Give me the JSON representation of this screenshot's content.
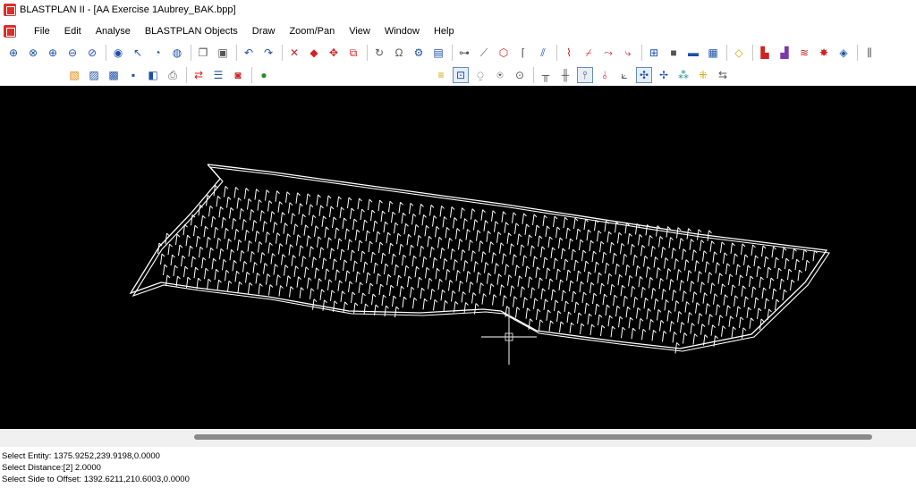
{
  "window": {
    "title": "BLASTPLAN II - [AA Exercise 1Aubrey_BAK.bpp]"
  },
  "menu": [
    "File",
    "Edit",
    "Analyse",
    "BLASTPLAN Objects",
    "Draw",
    "Zoom/Pan",
    "View",
    "Window",
    "Help"
  ],
  "toolbar1": [
    {
      "name": "zoom-extents-icon",
      "glyph": "⊕",
      "color": "blue"
    },
    {
      "name": "zoom-window-icon",
      "glyph": "⊗",
      "color": "blue"
    },
    {
      "name": "zoom-in-icon",
      "glyph": "⊕",
      "color": "blue"
    },
    {
      "name": "zoom-out-icon",
      "glyph": "⊖",
      "color": "blue"
    },
    {
      "name": "zoom-previous-icon",
      "glyph": "⊘",
      "color": "blue"
    },
    {
      "sep": true
    },
    {
      "name": "pan-icon",
      "glyph": "◉",
      "color": "blue"
    },
    {
      "name": "pick-icon",
      "glyph": "↖",
      "color": "blue"
    },
    {
      "name": "rotate-view-icon",
      "glyph": "◔",
      "color": "blue"
    },
    {
      "name": "globe-view-icon",
      "glyph": "◍",
      "color": "blue"
    },
    {
      "sep": true
    },
    {
      "name": "copy-icon",
      "glyph": "❐",
      "color": "gray"
    },
    {
      "name": "paste-icon",
      "glyph": "▣",
      "color": "gray"
    },
    {
      "sep": true
    },
    {
      "name": "undo-icon",
      "glyph": "↶",
      "color": "blue"
    },
    {
      "name": "redo-icon",
      "glyph": "↷",
      "color": "blue"
    },
    {
      "sep": true
    },
    {
      "name": "delete-icon",
      "glyph": "✕",
      "color": "red"
    },
    {
      "name": "erase-icon",
      "glyph": "◆",
      "color": "red"
    },
    {
      "name": "move-icon",
      "glyph": "✥",
      "color": "red"
    },
    {
      "name": "copy-object-icon",
      "glyph": "⧉",
      "color": "red"
    },
    {
      "sep": true
    },
    {
      "name": "refresh-icon",
      "glyph": "↻",
      "color": "gray"
    },
    {
      "name": "magnet-icon",
      "glyph": "Ω",
      "color": "gray"
    },
    {
      "name": "settings-icon",
      "glyph": "⚙",
      "color": "blue"
    },
    {
      "name": "layers-icon",
      "glyph": "▤",
      "color": "blue"
    },
    {
      "sep": true
    },
    {
      "name": "link-icon",
      "glyph": "⊶",
      "color": "gray"
    },
    {
      "name": "line-icon",
      "glyph": "⟋",
      "color": "gray"
    },
    {
      "name": "polygon-icon",
      "glyph": "⬡",
      "color": "red"
    },
    {
      "name": "fillet-icon",
      "glyph": "⌈",
      "color": "gray"
    },
    {
      "name": "offset-icon",
      "glyph": "⫽",
      "color": "blue"
    },
    {
      "sep": true
    },
    {
      "name": "break-icon",
      "glyph": "⌇",
      "color": "red"
    },
    {
      "name": "trim-icon",
      "glyph": "⌿",
      "color": "red"
    },
    {
      "name": "extend-icon",
      "glyph": "⤳",
      "color": "red"
    },
    {
      "name": "split-icon",
      "glyph": "⤷",
      "color": "red"
    },
    {
      "sep": true
    },
    {
      "name": "table-icon",
      "glyph": "⊞",
      "color": "blue"
    },
    {
      "name": "block-icon",
      "glyph": "■",
      "color": "gray"
    },
    {
      "name": "ruler-icon",
      "glyph": "▬",
      "color": "blue"
    },
    {
      "name": "grid-icon",
      "glyph": "▦",
      "color": "blue"
    },
    {
      "sep": true
    },
    {
      "name": "shape-icon",
      "glyph": "◇",
      "color": "yellow"
    },
    {
      "sep": true
    },
    {
      "name": "chart-icon",
      "glyph": "▙",
      "color": "red"
    },
    {
      "name": "histogram-icon",
      "glyph": "▟",
      "color": "purple"
    },
    {
      "name": "wave-icon",
      "glyph": "≋",
      "color": "red"
    },
    {
      "name": "burst-icon",
      "glyph": "✸",
      "color": "red"
    },
    {
      "name": "palette-icon",
      "glyph": "◈",
      "color": "blue"
    },
    {
      "sep": true
    },
    {
      "name": "comb-icon",
      "glyph": "⫼",
      "color": "gray"
    }
  ],
  "toolbar2": [
    {
      "name": "new-file-icon",
      "glyph": "▧",
      "color": "orange"
    },
    {
      "name": "open-file-icon",
      "glyph": "▨",
      "color": "blue"
    },
    {
      "name": "folder-icon",
      "glyph": "▩",
      "color": "blue"
    },
    {
      "name": "save-icon",
      "glyph": "▪",
      "color": "blue"
    },
    {
      "name": "save-all-icon",
      "glyph": "◧",
      "color": "blue"
    },
    {
      "name": "print-icon",
      "glyph": "⎙",
      "color": "gray"
    },
    {
      "sep": true
    },
    {
      "name": "export-icon",
      "glyph": "⇄",
      "color": "red"
    },
    {
      "name": "report-icon",
      "glyph": "☰",
      "color": "blue"
    },
    {
      "name": "image-icon",
      "glyph": "◙",
      "color": "red"
    },
    {
      "sep": true
    },
    {
      "name": "earth-icon",
      "glyph": "●",
      "color": "green"
    }
  ],
  "toolbar3": [
    {
      "name": "stack-icon",
      "glyph": "≡",
      "color": "yellow"
    },
    {
      "name": "pattern-icon",
      "glyph": "⊡",
      "color": "blue",
      "pressed": true
    },
    {
      "name": "marker-a-icon",
      "glyph": "⍜",
      "color": "gray"
    },
    {
      "name": "marker-b-icon",
      "glyph": "⍟",
      "color": "gray"
    },
    {
      "name": "marker-c-icon",
      "glyph": "⊙",
      "color": "gray"
    },
    {
      "sep": true
    },
    {
      "name": "holes-a-icon",
      "glyph": "╥",
      "color": "gray"
    },
    {
      "name": "holes-b-icon",
      "glyph": "╫",
      "color": "gray"
    },
    {
      "name": "holes-c-icon",
      "glyph": "⫯",
      "color": "gray",
      "pressed": true
    },
    {
      "name": "holes-d-icon",
      "glyph": "⫰",
      "color": "red"
    },
    {
      "name": "angle-icon",
      "glyph": "⟀",
      "color": "gray"
    },
    {
      "name": "compass-icon",
      "glyph": "✣",
      "color": "blue",
      "pressed": true
    },
    {
      "name": "cross-icon",
      "glyph": "✢",
      "color": "blue"
    },
    {
      "name": "grid-holes-icon",
      "glyph": "⁂",
      "color": "teal"
    },
    {
      "name": "array-icon",
      "glyph": "⁜",
      "color": "yellow"
    },
    {
      "name": "sequence-icon",
      "glyph": "⇆",
      "color": "gray"
    }
  ],
  "status": {
    "line1": "Select Entity: 1375.9252,239.9198,0.0000",
    "line2": "Select Distance:[2] 2.0000",
    "line3": "Select Side to Offset: 1392.6211,210.6003,0.0000"
  },
  "colors": {
    "canvas_bg": "#000000",
    "drawing": "#ffffff",
    "crosshair": "#cfcfcf"
  }
}
